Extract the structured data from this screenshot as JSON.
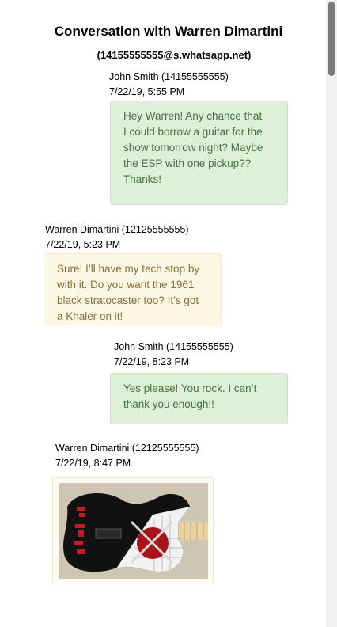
{
  "conversation": {
    "title": "Conversation with Warren Dimartini",
    "subtitle": "(14155555555@s.whatsapp.net)"
  },
  "messages": [
    {
      "sender": "John Smith (14155555555)",
      "time": "7/22/19, 5:55 PM",
      "lines": [
        "Hey Warren! Any chance that",
        "I could borrow a guitar for the",
        "show tomorrow night? Maybe",
        "the ESP with one pickup??",
        "Thanks!"
      ]
    },
    {
      "sender": "Warren Dimartini (12125555555)",
      "time": "7/22/19, 5:23 PM",
      "lines": [
        "Sure! I’ll have my tech stop by",
        "with it. Do you want the 1961",
        "black stratocaster too? It’s got",
        "a Khaler on it!"
      ]
    },
    {
      "sender": "John Smith (14155555555)",
      "time": "7/22/19, 8:23 PM",
      "lines": [
        "Yes please! You rock. I can’t",
        "thank you enough!!"
      ]
    },
    {
      "sender": "Warren Dimartini (12125555555)",
      "time": "7/22/19, 8:47 PM",
      "attachment": "guitar-photo"
    }
  ],
  "colors": {
    "outgoing_bg": "#dff0d8",
    "outgoing_text": "#3c763d",
    "incoming_bg": "#fcf8e3",
    "incoming_text": "#8a6d3b"
  }
}
